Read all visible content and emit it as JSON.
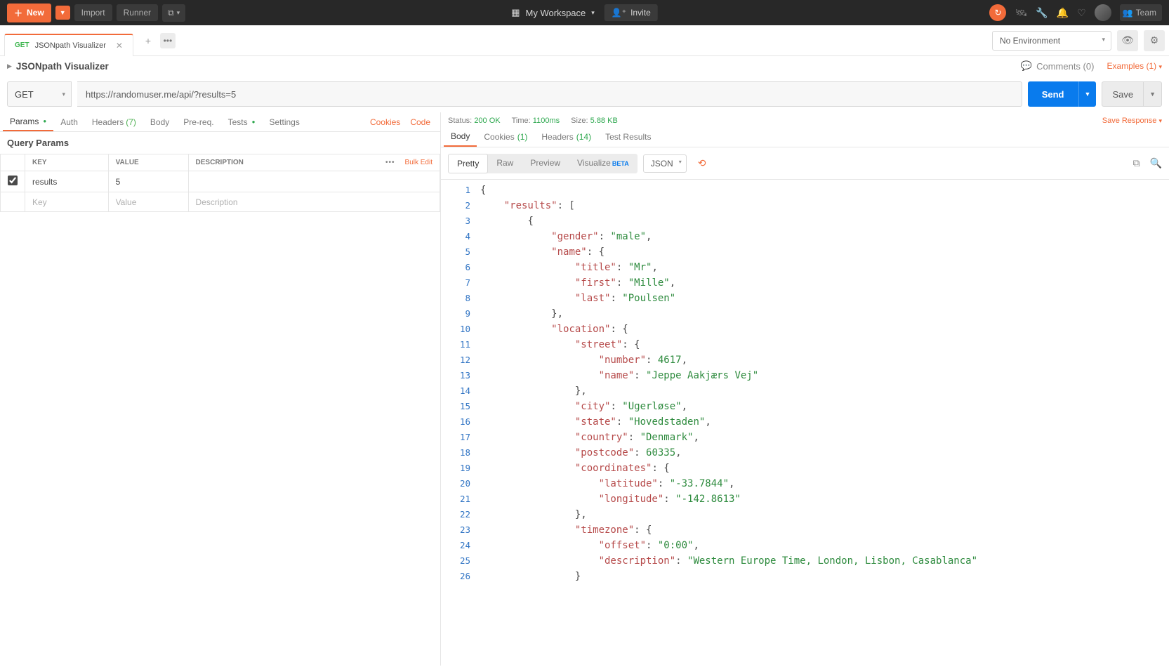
{
  "topbar": {
    "new_label": "New",
    "import_label": "Import",
    "runner_label": "Runner",
    "workspace_label": "My Workspace",
    "invite_label": "Invite",
    "team_label": "Team"
  },
  "tab": {
    "method": "GET",
    "name": "JSONpath Visualizer"
  },
  "environment": {
    "selected": "No Environment"
  },
  "breadcrumb": {
    "title": "JSONpath Visualizer",
    "comments": "Comments (0)",
    "examples": "Examples (1)"
  },
  "request": {
    "method": "GET",
    "url": "https://randomuser.me/api/?results=5",
    "send_label": "Send",
    "save_label": "Save"
  },
  "req_tabs": {
    "params": "Params",
    "auth": "Auth",
    "headers": "Headers",
    "headers_count": "(7)",
    "body": "Body",
    "prereq": "Pre-req.",
    "tests": "Tests",
    "settings": "Settings",
    "cookies": "Cookies",
    "code": "Code"
  },
  "query_params": {
    "title": "Query Params",
    "th_key": "KEY",
    "th_value": "VALUE",
    "th_desc": "DESCRIPTION",
    "bulk_edit": "Bulk Edit",
    "rows": [
      {
        "key": "results",
        "value": "5",
        "description": ""
      }
    ],
    "ph_key": "Key",
    "ph_value": "Value",
    "ph_desc": "Description"
  },
  "status": {
    "status_lbl": "Status:",
    "status_val": "200 OK",
    "time_lbl": "Time:",
    "time_val": "1100ms",
    "size_lbl": "Size:",
    "size_val": "5.88 KB",
    "save_response": "Save Response"
  },
  "resp_tabs": {
    "body": "Body",
    "cookies": "Cookies",
    "cookies_count": "(1)",
    "headers": "Headers",
    "headers_count": "(14)",
    "tests": "Test Results"
  },
  "views": {
    "pretty": "Pretty",
    "raw": "Raw",
    "preview": "Preview",
    "visualize": "Visualize",
    "format": "JSON"
  },
  "json_lines": [
    {
      "n": 1,
      "i": 0,
      "t": [
        [
          "punc",
          "{"
        ]
      ]
    },
    {
      "n": 2,
      "i": 1,
      "t": [
        [
          "key",
          "\"results\""
        ],
        [
          "punc",
          ": ["
        ]
      ]
    },
    {
      "n": 3,
      "i": 2,
      "t": [
        [
          "punc",
          "{"
        ]
      ]
    },
    {
      "n": 4,
      "i": 3,
      "t": [
        [
          "key",
          "\"gender\""
        ],
        [
          "punc",
          ": "
        ],
        [
          "str",
          "\"male\""
        ],
        [
          "punc",
          ","
        ]
      ]
    },
    {
      "n": 5,
      "i": 3,
      "t": [
        [
          "key",
          "\"name\""
        ],
        [
          "punc",
          ": {"
        ]
      ]
    },
    {
      "n": 6,
      "i": 4,
      "t": [
        [
          "key",
          "\"title\""
        ],
        [
          "punc",
          ": "
        ],
        [
          "str",
          "\"Mr\""
        ],
        [
          "punc",
          ","
        ]
      ]
    },
    {
      "n": 7,
      "i": 4,
      "t": [
        [
          "key",
          "\"first\""
        ],
        [
          "punc",
          ": "
        ],
        [
          "str",
          "\"Mille\""
        ],
        [
          "punc",
          ","
        ]
      ]
    },
    {
      "n": 8,
      "i": 4,
      "t": [
        [
          "key",
          "\"last\""
        ],
        [
          "punc",
          ": "
        ],
        [
          "str",
          "\"Poulsen\""
        ]
      ]
    },
    {
      "n": 9,
      "i": 3,
      "t": [
        [
          "punc",
          "},"
        ]
      ]
    },
    {
      "n": 10,
      "i": 3,
      "t": [
        [
          "key",
          "\"location\""
        ],
        [
          "punc",
          ": {"
        ]
      ]
    },
    {
      "n": 11,
      "i": 4,
      "t": [
        [
          "key",
          "\"street\""
        ],
        [
          "punc",
          ": {"
        ]
      ]
    },
    {
      "n": 12,
      "i": 5,
      "t": [
        [
          "key",
          "\"number\""
        ],
        [
          "punc",
          ": "
        ],
        [
          "num",
          "4617"
        ],
        [
          "punc",
          ","
        ]
      ]
    },
    {
      "n": 13,
      "i": 5,
      "t": [
        [
          "key",
          "\"name\""
        ],
        [
          "punc",
          ": "
        ],
        [
          "str",
          "\"Jeppe Aakjærs Vej\""
        ]
      ]
    },
    {
      "n": 14,
      "i": 4,
      "t": [
        [
          "punc",
          "},"
        ]
      ]
    },
    {
      "n": 15,
      "i": 4,
      "t": [
        [
          "key",
          "\"city\""
        ],
        [
          "punc",
          ": "
        ],
        [
          "str",
          "\"Ugerløse\""
        ],
        [
          "punc",
          ","
        ]
      ]
    },
    {
      "n": 16,
      "i": 4,
      "t": [
        [
          "key",
          "\"state\""
        ],
        [
          "punc",
          ": "
        ],
        [
          "str",
          "\"Hovedstaden\""
        ],
        [
          "punc",
          ","
        ]
      ]
    },
    {
      "n": 17,
      "i": 4,
      "t": [
        [
          "key",
          "\"country\""
        ],
        [
          "punc",
          ": "
        ],
        [
          "str",
          "\"Denmark\""
        ],
        [
          "punc",
          ","
        ]
      ]
    },
    {
      "n": 18,
      "i": 4,
      "t": [
        [
          "key",
          "\"postcode\""
        ],
        [
          "punc",
          ": "
        ],
        [
          "num",
          "60335"
        ],
        [
          "punc",
          ","
        ]
      ]
    },
    {
      "n": 19,
      "i": 4,
      "t": [
        [
          "key",
          "\"coordinates\""
        ],
        [
          "punc",
          ": {"
        ]
      ]
    },
    {
      "n": 20,
      "i": 5,
      "t": [
        [
          "key",
          "\"latitude\""
        ],
        [
          "punc",
          ": "
        ],
        [
          "str",
          "\"-33.7844\""
        ],
        [
          "punc",
          ","
        ]
      ]
    },
    {
      "n": 21,
      "i": 5,
      "t": [
        [
          "key",
          "\"longitude\""
        ],
        [
          "punc",
          ": "
        ],
        [
          "str",
          "\"-142.8613\""
        ]
      ]
    },
    {
      "n": 22,
      "i": 4,
      "t": [
        [
          "punc",
          "},"
        ]
      ]
    },
    {
      "n": 23,
      "i": 4,
      "t": [
        [
          "key",
          "\"timezone\""
        ],
        [
          "punc",
          ": {"
        ]
      ]
    },
    {
      "n": 24,
      "i": 5,
      "t": [
        [
          "key",
          "\"offset\""
        ],
        [
          "punc",
          ": "
        ],
        [
          "str",
          "\"0:00\""
        ],
        [
          "punc",
          ","
        ]
      ]
    },
    {
      "n": 25,
      "i": 5,
      "t": [
        [
          "key",
          "\"description\""
        ],
        [
          "punc",
          ": "
        ],
        [
          "str",
          "\"Western Europe Time, London, Lisbon, Casablanca\""
        ]
      ]
    },
    {
      "n": 26,
      "i": 4,
      "t": [
        [
          "punc",
          "}"
        ]
      ]
    }
  ]
}
